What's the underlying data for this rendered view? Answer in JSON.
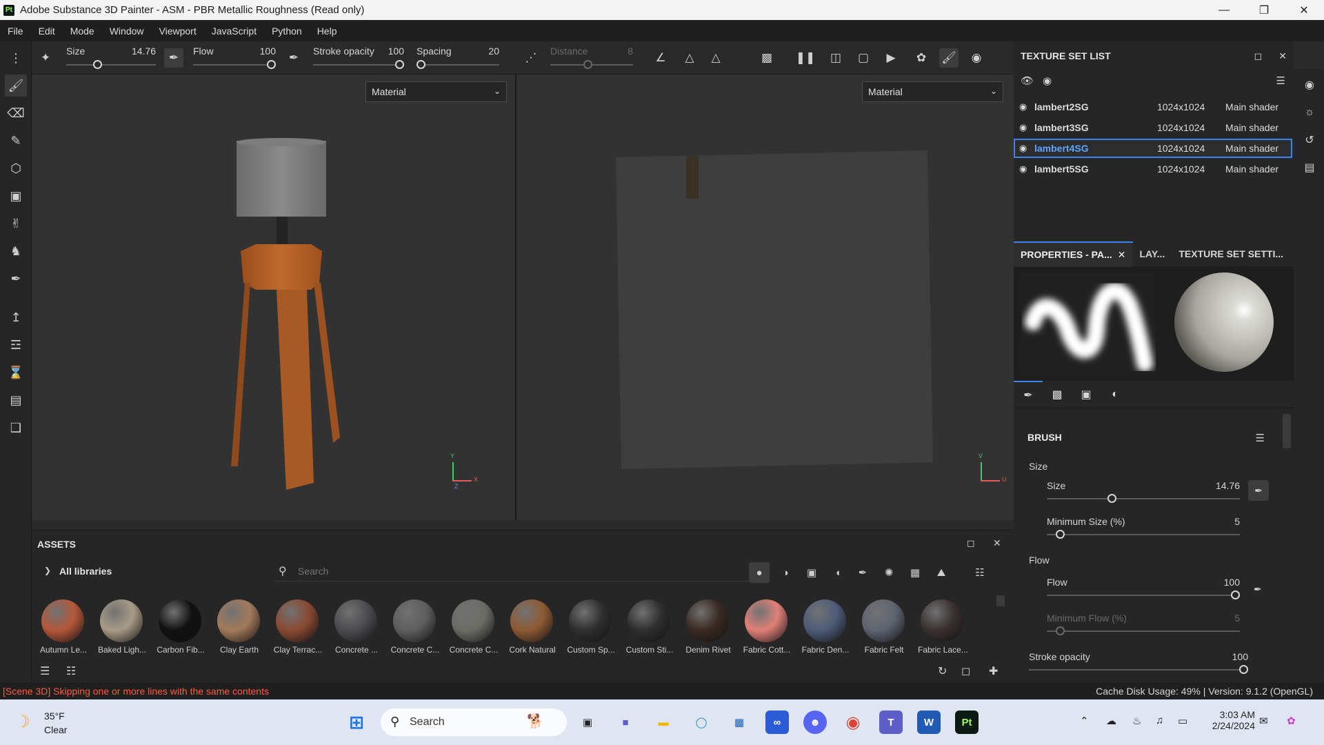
{
  "window": {
    "title": "Adobe Substance 3D Painter - ASM - PBR Metallic Roughness (Read only)",
    "app_badge": "Pt",
    "controls": [
      "minimize-icon",
      "restore-icon",
      "close-icon"
    ]
  },
  "menu": [
    "File",
    "Edit",
    "Mode",
    "Window",
    "Viewport",
    "JavaScript",
    "Python",
    "Help"
  ],
  "brushbar": {
    "size": {
      "label": "Size",
      "value": "14.76",
      "fraction": 0.33
    },
    "flow": {
      "label": "Flow",
      "value": "100",
      "fraction": 1.0
    },
    "stroke_opacity": {
      "label": "Stroke opacity",
      "value": "100",
      "fraction": 1.0
    },
    "spacing": {
      "label": "Spacing",
      "value": "20",
      "fraction": 0.0
    },
    "distance": {
      "label": "Distance",
      "value": "8",
      "fraction": 0.45
    }
  },
  "viewports": {
    "left_mode": "Material",
    "right_mode": "Material",
    "left_axes": {
      "y": "Y",
      "x": "X",
      "z": "Z"
    },
    "right_axes": {
      "v": "V",
      "u": "U"
    }
  },
  "texture_set_list": {
    "title": "TEXTURE SET LIST",
    "rows": [
      {
        "name": "lambert2SG",
        "resolution": "1024x1024",
        "shader": "Main shader",
        "selected": false
      },
      {
        "name": "lambert3SG",
        "resolution": "1024x1024",
        "shader": "Main shader",
        "selected": false
      },
      {
        "name": "lambert4SG",
        "resolution": "1024x1024",
        "shader": "Main shader",
        "selected": true
      },
      {
        "name": "lambert5SG",
        "resolution": "1024x1024",
        "shader": "Main shader",
        "selected": false
      }
    ]
  },
  "properties": {
    "tabs": [
      "PROPERTIES - PA...",
      "LAY...",
      "TEXTURE SET SETTI..."
    ],
    "section": "BRUSH",
    "size_group": "Size",
    "size": {
      "label": "Size",
      "value": "14.76",
      "fraction": 0.33
    },
    "min_size": {
      "label": "Minimum Size (%)",
      "value": "5",
      "fraction": 0.05
    },
    "flow_group": "Flow",
    "flow": {
      "label": "Flow",
      "value": "100",
      "fraction": 1.0
    },
    "min_flow": {
      "label": "Minimum Flow (%)",
      "value": "5",
      "fraction": 0.05
    },
    "stroke_opacity": {
      "label": "Stroke opacity",
      "value": "100",
      "fraction": 1.0
    }
  },
  "assets": {
    "title": "ASSETS",
    "library": "All libraries",
    "search_placeholder": "Search",
    "items": [
      {
        "name": "Autumn Le...",
        "color": "#b5583a"
      },
      {
        "name": "Baked Ligh...",
        "color": "#a89b86"
      },
      {
        "name": "Carbon Fib...",
        "color": "#111111"
      },
      {
        "name": "Clay Earth",
        "color": "#a37a5a"
      },
      {
        "name": "Clay Terrac...",
        "color": "#8a4a32"
      },
      {
        "name": "Concrete ...",
        "color": "#4c4c50"
      },
      {
        "name": "Concrete C...",
        "color": "#5e5e5e"
      },
      {
        "name": "Concrete C...",
        "color": "#6c6c66"
      },
      {
        "name": "Cork Natural",
        "color": "#8e5a34"
      },
      {
        "name": "Custom Sp...",
        "color": "#2f2f2f"
      },
      {
        "name": "Custom Sti...",
        "color": "#2f2f2f"
      },
      {
        "name": "Denim Rivet",
        "color": "#3a2a22"
      },
      {
        "name": "Fabric Cott...",
        "color": "#e08078"
      },
      {
        "name": "Fabric Den...",
        "color": "#4e5c78"
      },
      {
        "name": "Fabric Felt",
        "color": "#5e6470"
      },
      {
        "name": "Fabric Lace...",
        "color": "#3a3030"
      }
    ]
  },
  "status": {
    "message": "[Scene 3D] Skipping one or more lines with the same contents",
    "info": "Cache Disk Usage:  49% | Version: 9.1.2 (OpenGL)"
  },
  "taskbar": {
    "temperature": "35°F",
    "condition": "Clear",
    "search_label": "Search",
    "time": "3:03 AM",
    "date": "2/24/2024"
  }
}
